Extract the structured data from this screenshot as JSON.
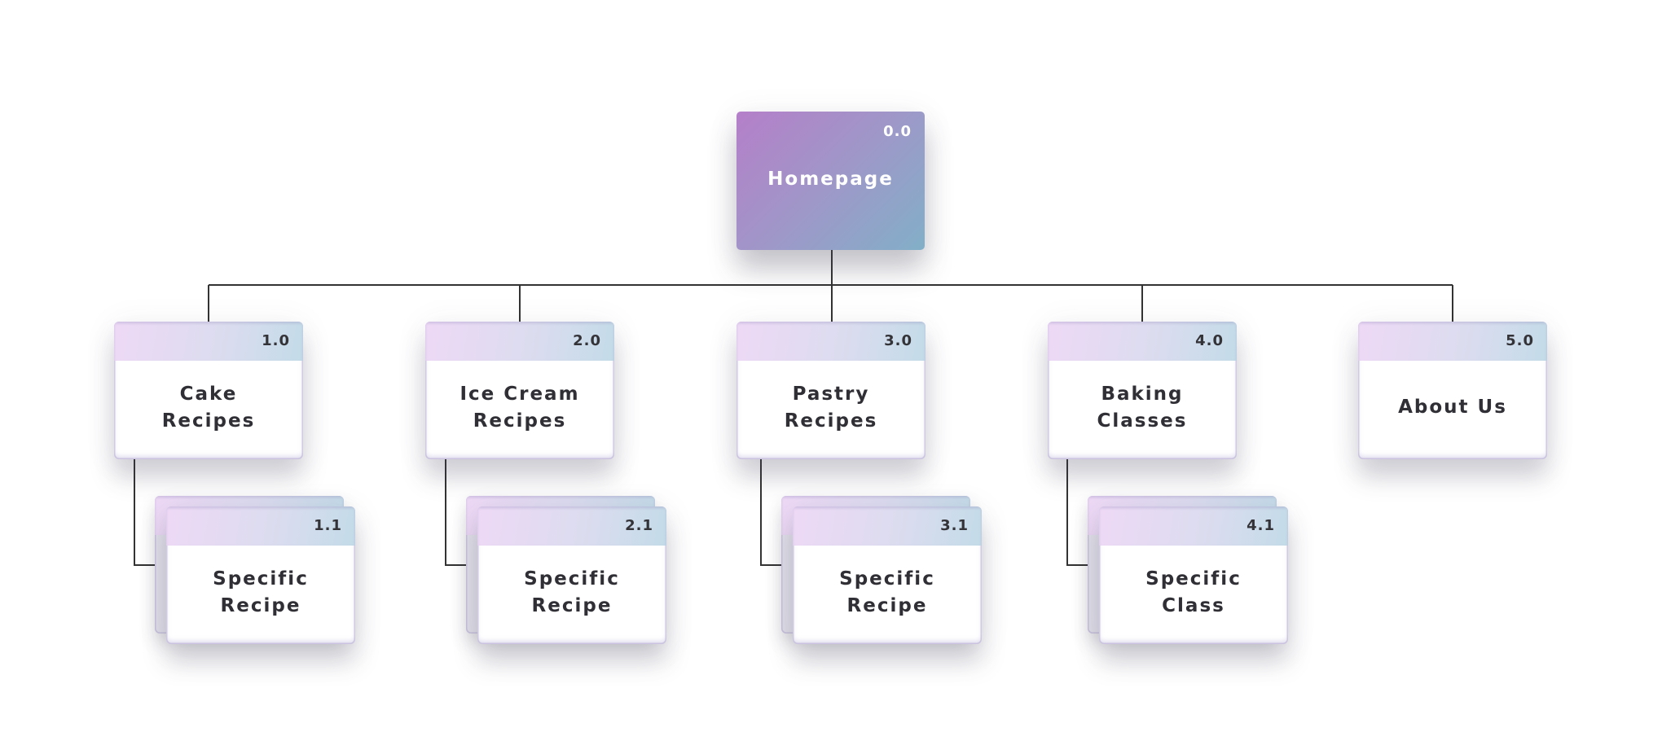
{
  "diagram": {
    "type": "sitemap-hierarchy",
    "colors": {
      "root_gradient_start": "#b57fc9",
      "root_gradient_end": "#82afc8",
      "header_gradient_start": "#eed9f6",
      "header_gradient_end": "#c3dbe8",
      "connector": "#333333",
      "text": "#2f2f35"
    },
    "root": {
      "id": "0.0",
      "label": "Homepage"
    },
    "sections": [
      {
        "id": "1.0",
        "label": "Cake Recipes",
        "child": {
          "id": "1.1",
          "label": "Specific\nRecipe",
          "stacked": true
        }
      },
      {
        "id": "2.0",
        "label": "Ice Cream\nRecipes",
        "child": {
          "id": "2.1",
          "label": "Specific\nRecipe",
          "stacked": true
        }
      },
      {
        "id": "3.0",
        "label": "Pastry\nRecipes",
        "child": {
          "id": "3.1",
          "label": "Specific\nRecipe",
          "stacked": true
        }
      },
      {
        "id": "4.0",
        "label": "Baking\nClasses",
        "child": {
          "id": "4.1",
          "label": "Specific\nClass",
          "stacked": true
        }
      },
      {
        "id": "5.0",
        "label": "About Us",
        "child": null
      }
    ]
  }
}
